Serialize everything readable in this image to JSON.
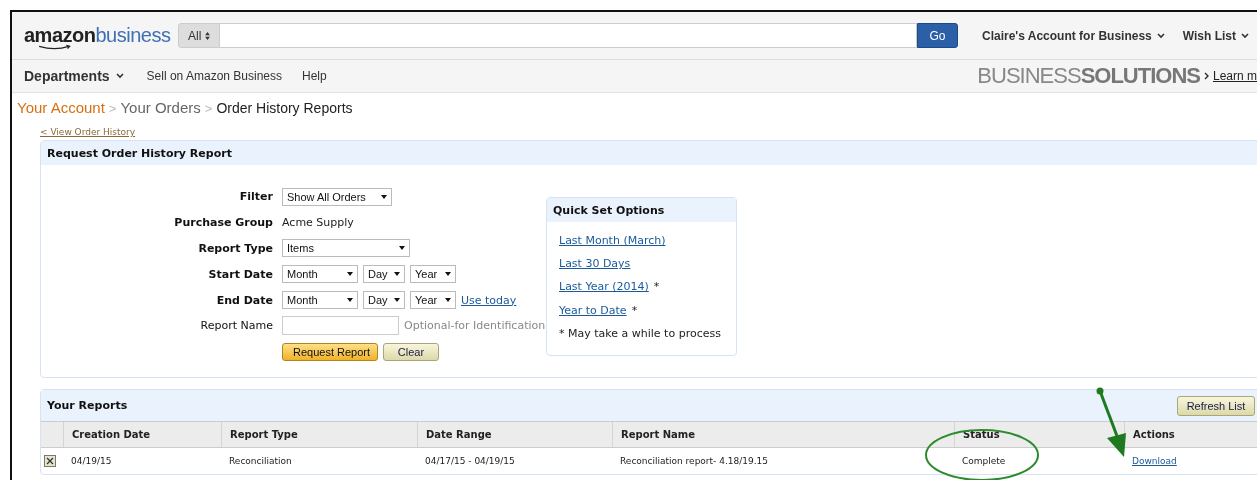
{
  "header": {
    "logo": {
      "brand": "amazon",
      "suffix": "business"
    },
    "search": {
      "category": "All",
      "button": "Go"
    },
    "menus": [
      "Claire's Account for Business",
      "Wish List"
    ]
  },
  "nav": {
    "items": [
      "Departments",
      "Sell on Amazon Business",
      "Help"
    ],
    "promo": {
      "light": "BUSINESS",
      "bold": "SOLUTIONS",
      "link": "Learn m"
    }
  },
  "breadcrumb": {
    "separator": ">",
    "items": [
      {
        "label": "Your Account",
        "kind": "link"
      },
      {
        "label": "Your Orders",
        "kind": "parent"
      },
      {
        "label": "Order History Reports",
        "kind": "current"
      }
    ]
  },
  "back_link": "< View Order History",
  "request_panel": {
    "title": "Request Order History Report",
    "fields": [
      {
        "label": "Filter",
        "bold": true,
        "kind": "select",
        "value": "Show All Orders"
      },
      {
        "label": "Purchase Group",
        "bold": true,
        "kind": "text",
        "value": "Acme Supply"
      },
      {
        "label": "Report Type",
        "bold": true,
        "kind": "select",
        "value": "Items"
      },
      {
        "label": "Start Date",
        "bold": true,
        "kind": "date",
        "parts": [
          "Month",
          "Day",
          "Year"
        ]
      },
      {
        "label": "End Date",
        "bold": true,
        "kind": "date",
        "parts": [
          "Month",
          "Day",
          "Year"
        ],
        "link": "Use today"
      },
      {
        "label": "Report Name",
        "bold": false,
        "kind": "input",
        "hint": "Optional-for Identification"
      }
    ],
    "buttons": [
      {
        "label": "Request Report",
        "kind": "primary"
      },
      {
        "label": "Clear",
        "kind": "secondary"
      }
    ],
    "quick_set": {
      "title": "Quick Set Options",
      "links": [
        {
          "label": "Last Month (March)"
        },
        {
          "label": "Last 30 Days"
        },
        {
          "label": "Last Year (2014)",
          "note": "*"
        },
        {
          "label": "Year to Date",
          "note": "*"
        }
      ],
      "footnote": "* May take a while to process"
    }
  },
  "reports_panel": {
    "title": "Your Reports",
    "refresh_button": "Refresh List",
    "columns": [
      "Creation Date",
      "Report Type",
      "Date Range",
      "Report Name",
      "Status",
      "Actions"
    ],
    "rows": [
      {
        "cells": [
          "04/19/15",
          "Reconciliation",
          "04/17/15 - 04/19/15",
          "Reconciliation report- 4.18/19.15",
          "Complete"
        ],
        "action": "Download"
      }
    ]
  }
}
